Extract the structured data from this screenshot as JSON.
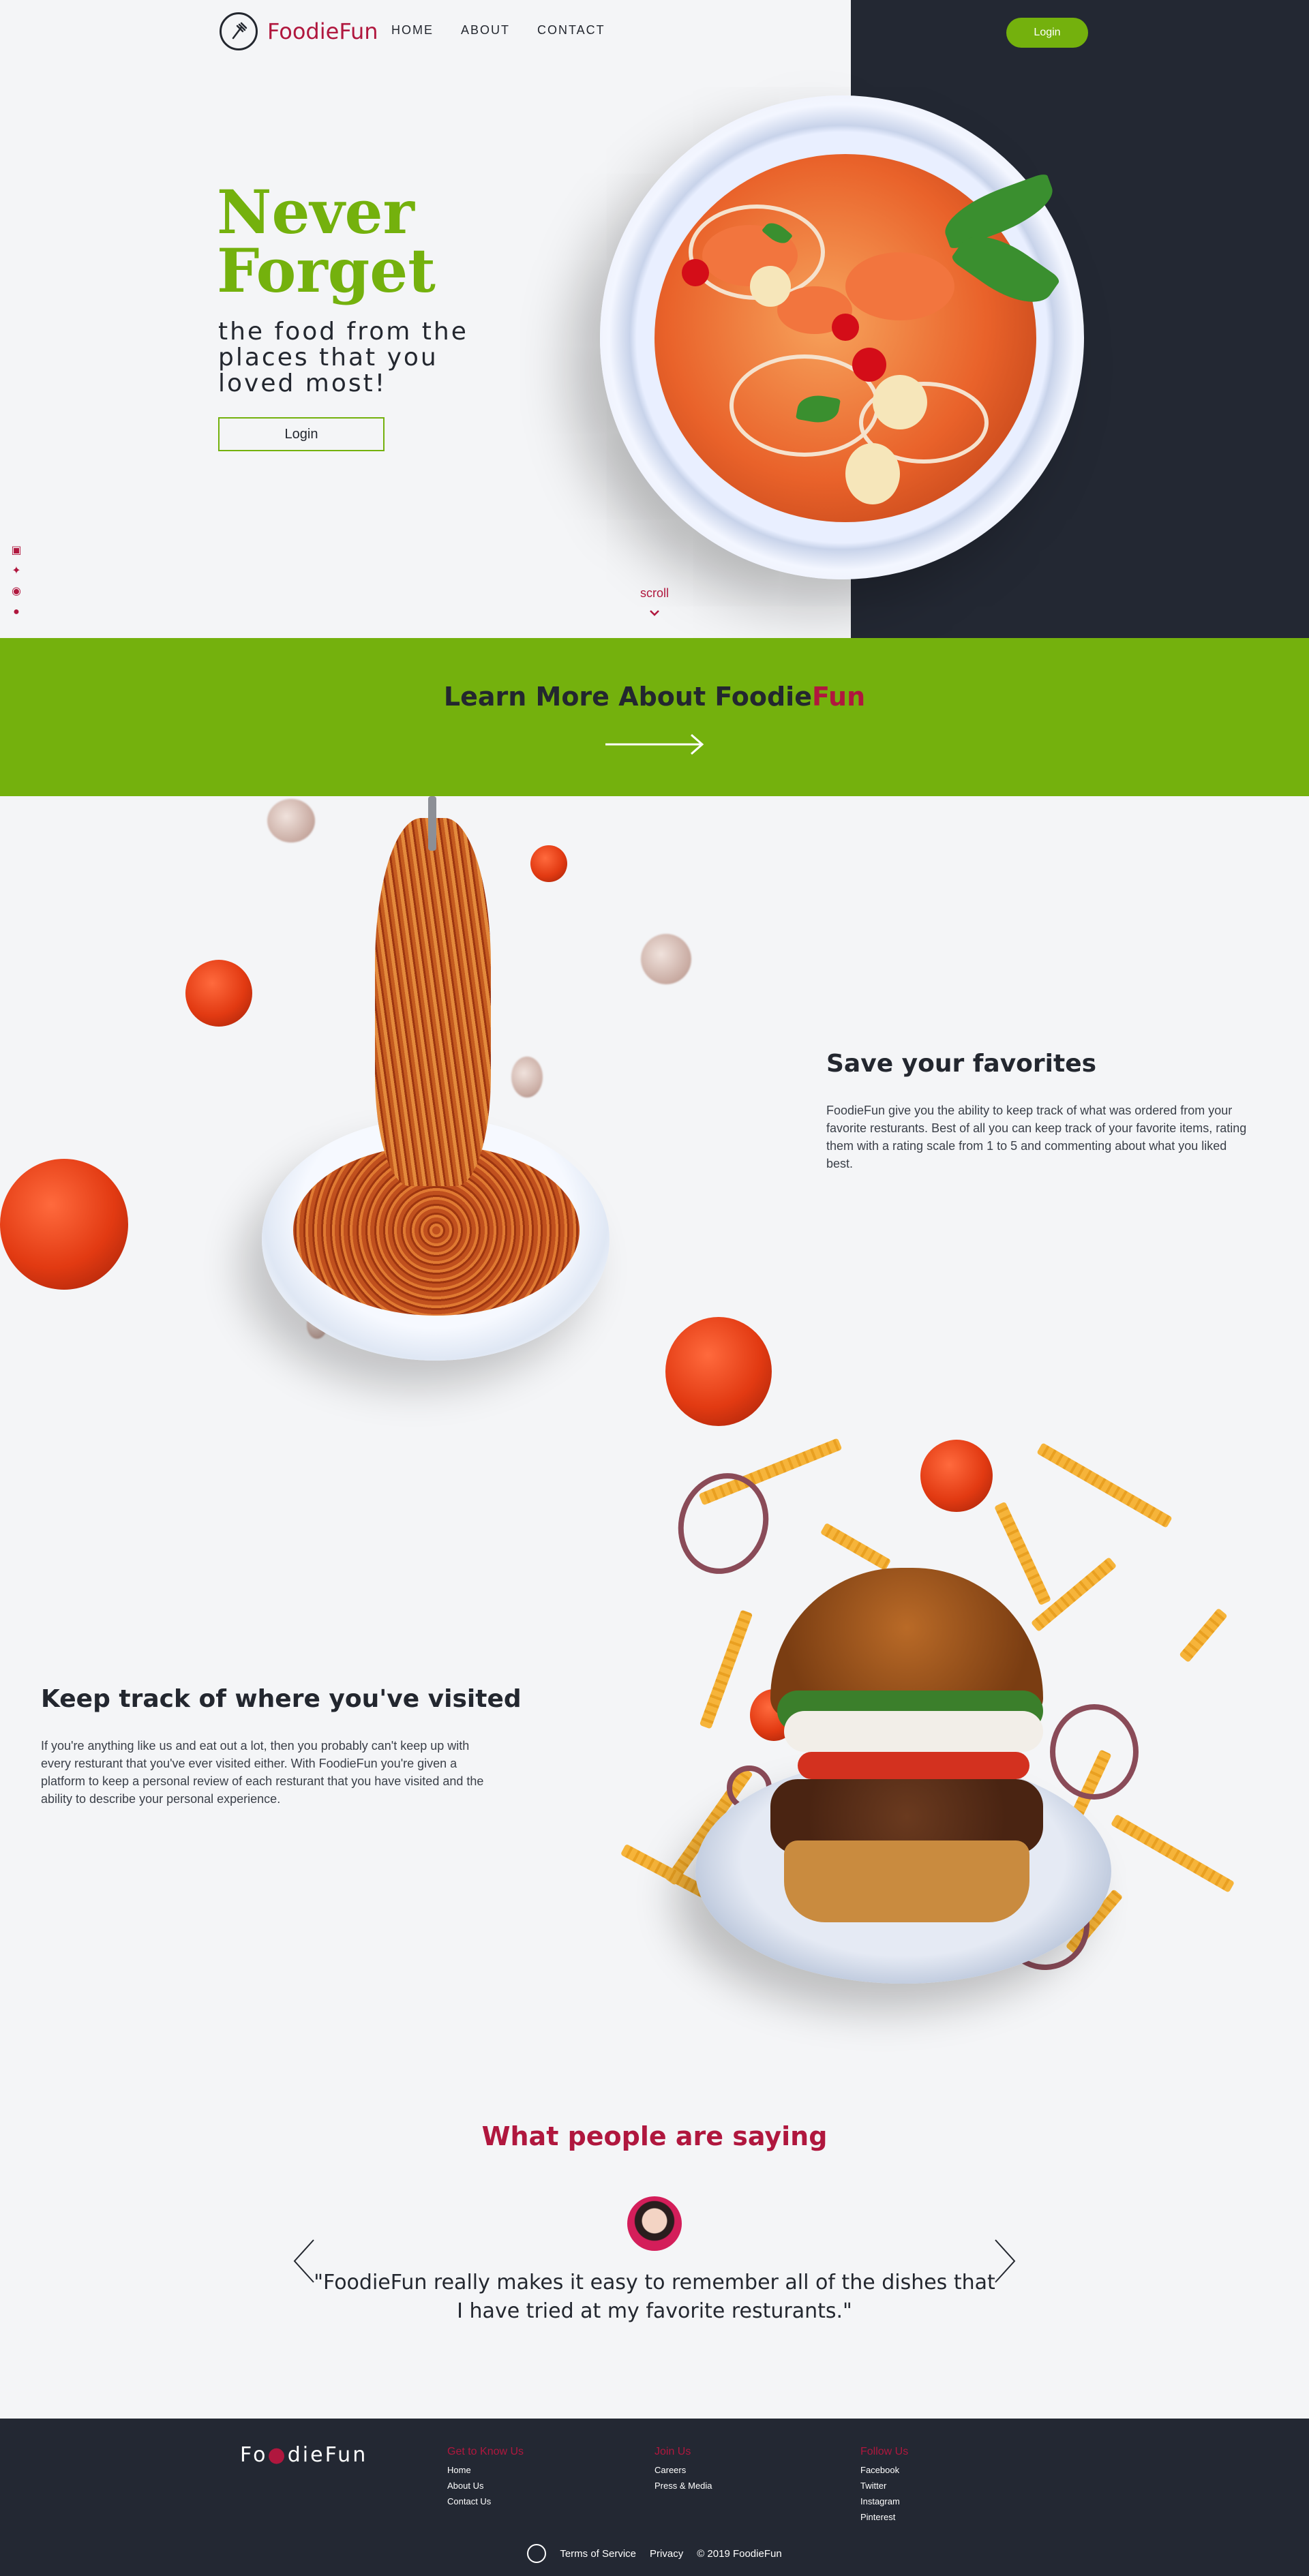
{
  "header": {
    "brand": "FoodieFun",
    "nav": [
      "HOME",
      "ABOUT",
      "CONTACT"
    ],
    "login_button": "Login"
  },
  "hero": {
    "title_line1": "Never",
    "title_line2": "Forget",
    "subtitle": "the food from the places that you loved most!",
    "login_button": "Login",
    "scroll_label": "scroll",
    "social_icons": [
      "facebook-icon",
      "twitter-icon",
      "instagram-icon",
      "pinterest-icon"
    ]
  },
  "band": {
    "title_main": "Learn More About Foodie",
    "title_accent": "Fun"
  },
  "features": [
    {
      "title": "Save your favorites",
      "body": "FoodieFun give you the ability to keep track of what was ordered from your favorite resturants. Best of all you can keep track of your favorite items, rating them with a rating scale from 1 to 5 and commenting about what you liked best."
    },
    {
      "title": "Keep track of where you've visited",
      "body": "If you're anything like us and eat out a lot, then you probably can't keep up with every resturant that you've ever visited either. With FoodieFun you're given a platform to keep a personal review of each resturant that you have visited and the ability to describe your personal experience."
    }
  ],
  "testimonials": {
    "title": "What people are saying",
    "quote": "\"FoodieFun really makes it easy to remember all of the dishes that I have tried at my favorite resturants.\""
  },
  "footer": {
    "brand_left": "Fo",
    "brand_right": "dieFun",
    "columns": [
      {
        "heading": "Get to Know Us",
        "links": [
          "Home",
          "About Us",
          "Contact Us"
        ]
      },
      {
        "heading": "Join Us",
        "links": [
          "Careers",
          "Press & Media"
        ]
      },
      {
        "heading": "Follow Us",
        "links": [
          "Facebook",
          "Twitter",
          "Instagram",
          "Pinterest"
        ]
      }
    ],
    "bottom": {
      "terms": "Terms of Service",
      "privacy": "Privacy",
      "copyright": "© 2019 FoodieFun"
    }
  },
  "colors": {
    "accent_green": "#74b10d",
    "brand_red": "#b0173e",
    "dark_navy": "#232833",
    "background": "#f4f5f7"
  }
}
